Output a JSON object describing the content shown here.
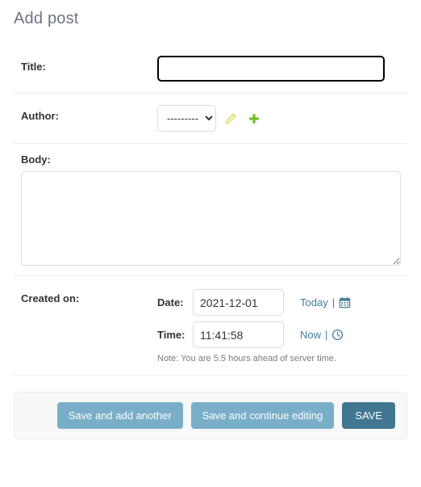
{
  "page": {
    "title": "Add post"
  },
  "form": {
    "rows": [
      {
        "label": "Title:",
        "name": "title"
      },
      {
        "label": "Author:",
        "name": "author"
      },
      {
        "label": "Body:",
        "name": "body"
      },
      {
        "label": "Created on:",
        "name": "created_on"
      }
    ],
    "title_field": {
      "value": "",
      "placeholder": "",
      "focused": true
    },
    "author_field": {
      "selected_option": "---------",
      "options": [
        "---------"
      ],
      "edit_icon": "pencil-icon",
      "add_icon": "plus-icon",
      "edit_icon_color": "#efefa0",
      "add_icon_color": "#70bf2b"
    },
    "body_field": {
      "value": "",
      "placeholder": ""
    },
    "created_on": {
      "date_label": "Date:",
      "date_value": "2021-12-01",
      "date_shortcut": "Today",
      "date_separator": "|",
      "date_icon": "calendar-icon",
      "time_label": "Time:",
      "time_value": "11:41:58",
      "time_shortcut": "Now",
      "time_separator": "|",
      "time_icon": "clock-icon",
      "note": "Note: You are 5.5 hours ahead of server time."
    }
  },
  "submit_row": {
    "save_and_add_another": "Save and add another",
    "save_and_continue": "Save and continue editing",
    "save": "SAVE"
  },
  "colors": {
    "heading": "#6d7580",
    "link": "#447e9b",
    "button_secondary": "#79aec8",
    "button_primary": "#417690",
    "divider": "#eeeeee",
    "panel": "#f8f8f8"
  }
}
